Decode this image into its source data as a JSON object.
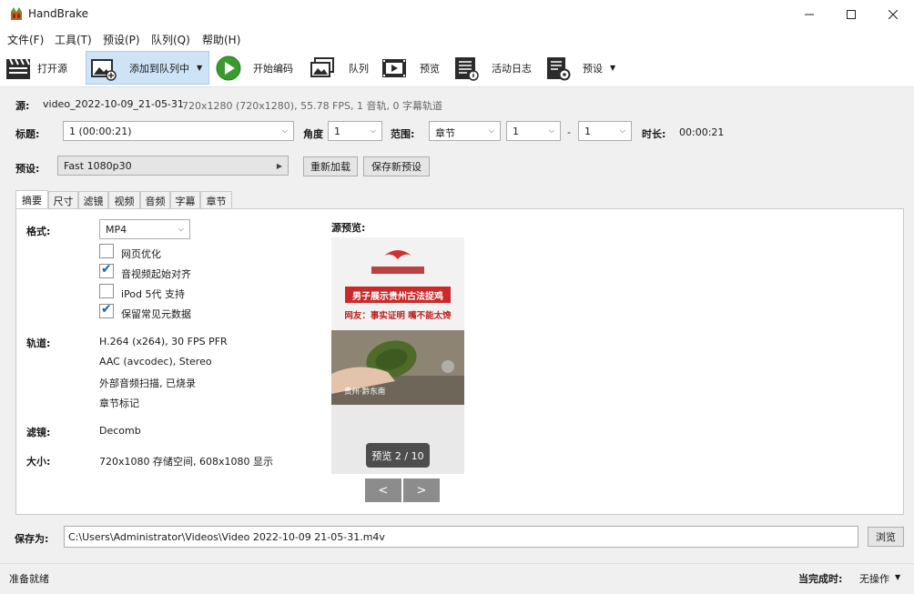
{
  "window": {
    "title": "HandBrake"
  },
  "menu": [
    "文件(F)",
    "工具(T)",
    "预设(P)",
    "队列(Q)",
    "帮助(H)"
  ],
  "toolbar": {
    "open_source": "打开源",
    "add_to_queue": "添加到队列中",
    "start_encode": "开始编码",
    "queue": "队列",
    "preview": "预览",
    "activity_log": "活动日志",
    "presets": "预设"
  },
  "source": {
    "label": "源:",
    "filename": "video_2022-10-09_21-05-31",
    "details": "720x1280 (720x1280), 55.78 FPS, 1 音轨, 0 字幕轨道"
  },
  "title_row": {
    "title_label": "标题:",
    "title_value": "1  (00:00:21)",
    "angle_label": "角度",
    "angle_value": "1",
    "range_label": "范围:",
    "range_type": "章节",
    "range_start": "1",
    "range_sep": "-",
    "range_end": "1",
    "duration_label": "时长:",
    "duration_value": "00:00:21"
  },
  "preset_row": {
    "label": "预设:",
    "value": "Fast 1080p30",
    "reload": "重新加载",
    "save_new": "保存新预设"
  },
  "tabs": [
    "摘要",
    "尺寸",
    "滤镜",
    "视频",
    "音频",
    "字幕",
    "章节"
  ],
  "summary": {
    "format_label": "格式:",
    "format_value": "MP4",
    "options": [
      {
        "label": "网页优化",
        "checked": false
      },
      {
        "label": "音视频起始对齐",
        "checked": true
      },
      {
        "label": "iPod 5代 支持",
        "checked": false
      },
      {
        "label": "保留常见元数据",
        "checked": true
      }
    ],
    "tracks_label": "轨道:",
    "tracks": [
      "H.264 (x264), 30 FPS PFR",
      "AAC (avcodec), Stereo",
      "外部音频扫描, 已烧录",
      "章节标记"
    ],
    "filters_label": "滤镜:",
    "filters_value": "Decomb",
    "size_label": "大小:",
    "size_value": "720x1080 存储空间, 608x1080 显示"
  },
  "preview": {
    "label": "源预览:",
    "banner": "男子展示贵州古法捉鸡",
    "subtitle": "网友：事实证明 嘴不能太馋",
    "caption": "贵州·黔东南",
    "counter": "预览 2 / 10",
    "prev": "<",
    "next": ">"
  },
  "save": {
    "label": "保存为:",
    "path": "C:\\Users\\Administrator\\Videos\\Video 2022-10-09 21-05-31.m4v",
    "browse": "浏览"
  },
  "status": {
    "text": "准备就绪",
    "when_done_label": "当完成时:",
    "when_done_value": "无操作"
  }
}
